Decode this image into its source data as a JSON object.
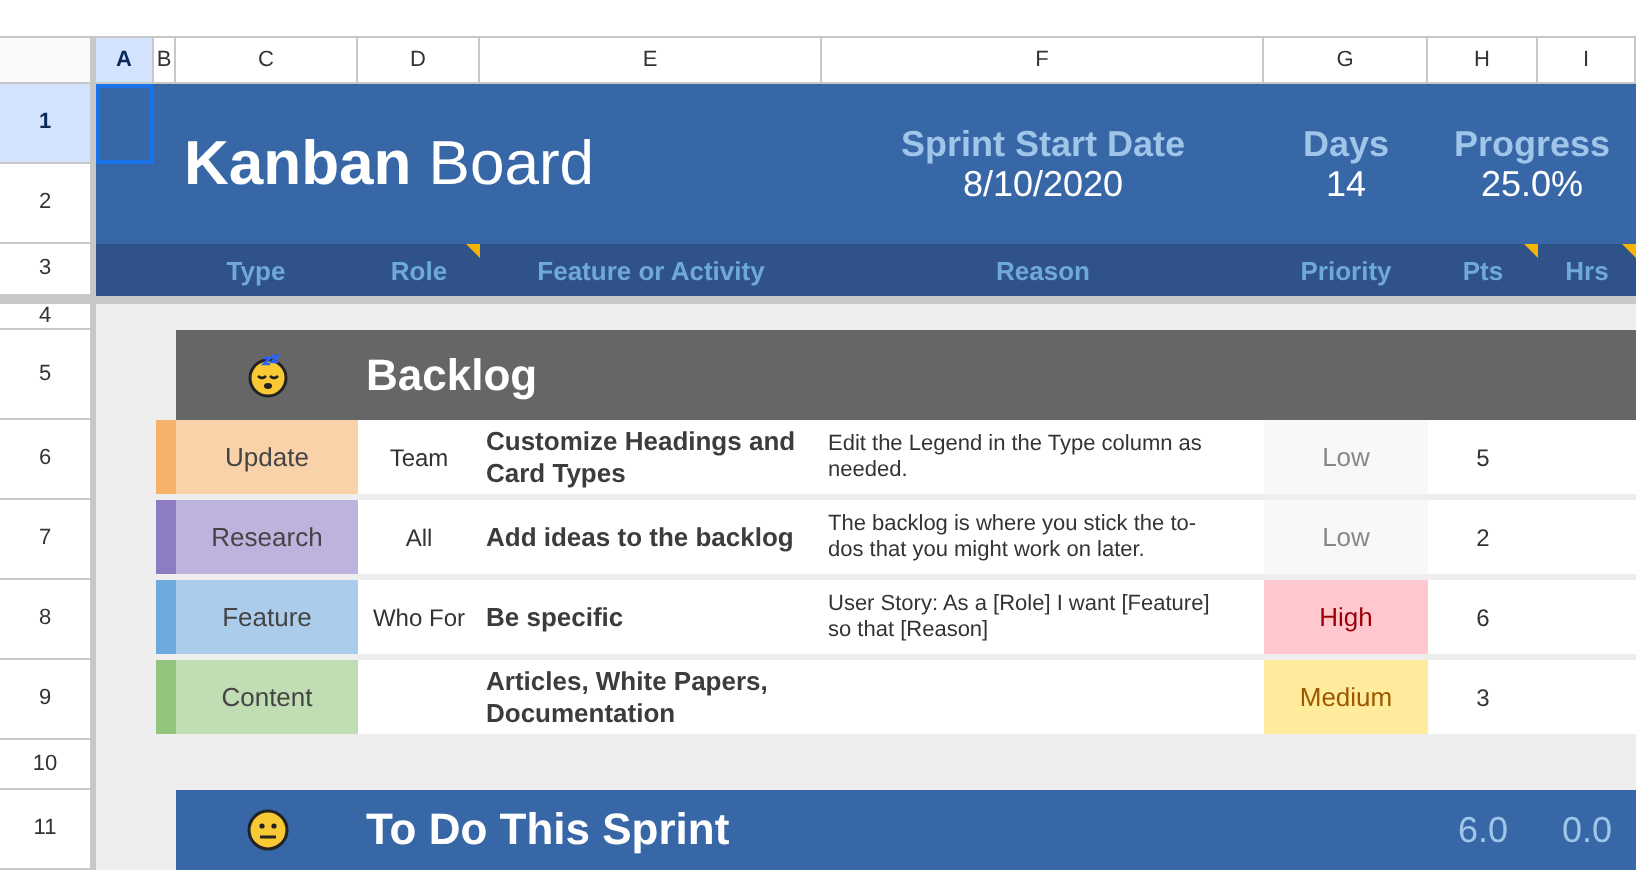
{
  "column_headers": [
    {
      "label": "A",
      "selected": true
    },
    {
      "label": "B",
      "selected": false
    },
    {
      "label": "C",
      "selected": false
    },
    {
      "label": "D",
      "selected": false
    },
    {
      "label": "E",
      "selected": false
    },
    {
      "label": "F",
      "selected": false
    },
    {
      "label": "G",
      "selected": false
    },
    {
      "label": "H",
      "selected": false
    },
    {
      "label": "I",
      "selected": false
    }
  ],
  "row_headers": [
    {
      "label": "1",
      "selected": true
    },
    {
      "label": "2",
      "selected": false
    },
    {
      "label": "3",
      "selected": false
    },
    {
      "label": "4",
      "selected": false
    },
    {
      "label": "5",
      "selected": false
    },
    {
      "label": "6",
      "selected": false
    },
    {
      "label": "7",
      "selected": false
    },
    {
      "label": "8",
      "selected": false
    },
    {
      "label": "9",
      "selected": false
    },
    {
      "label": "10",
      "selected": false
    },
    {
      "label": "11",
      "selected": false
    }
  ],
  "banner": {
    "title": "**Kanban** Board",
    "sprint_start_label": "Sprint Start Date",
    "sprint_start": "8/10/2020",
    "days_label": "Days",
    "days": "14",
    "progress_label": "Progress",
    "progress": "25.0%"
  },
  "table_header": [
    {
      "label": "Type",
      "note": false
    },
    {
      "label": "Role",
      "note": true
    },
    {
      "label": "Feature or Activity",
      "note": false
    },
    {
      "label": "Reason",
      "note": false
    },
    {
      "label": "Priority",
      "note": false
    },
    {
      "label": "Pts",
      "note": true
    },
    {
      "label": "Hrs",
      "note": true
    }
  ],
  "sections": [
    {
      "title": "Backlog",
      "kind": "sleepy",
      "color": "#666666",
      "cards": [
        {
          "type": "Update",
          "color": "#f6b26b",
          "role": "Team",
          "feature": "Customize Headings and Card Types",
          "reason": "Edit the Legend in the Type column as needed.",
          "priority": {
            "text": "Low",
            "kind": "low"
          },
          "pts": "5"
        },
        {
          "type": "Research",
          "color": "#8e7cc3",
          "role": "All",
          "feature": "Add ideas to the backlog",
          "reason": "The backlog is where you stick the to-dos that you might work on later.",
          "priority": {
            "text": "Low",
            "kind": "low"
          },
          "pts": "2"
        },
        {
          "type": "Feature",
          "color": "#6fa8dc",
          "role": "Who For",
          "feature": "Be specific",
          "reason": "User Story: As a [Role] I want [Feature] so that [Reason]",
          "priority": {
            "text": "High",
            "kind": "high"
          },
          "pts": "6"
        },
        {
          "type": "Content",
          "color": "#93c47d",
          "feature": "Articles, White Papers, Documentation",
          "priority": {
            "text": "Medium",
            "kind": "medium"
          },
          "pts": "3"
        }
      ]
    },
    {
      "title": "To Do This Sprint",
      "kind": "neutral",
      "color": "#3867a8",
      "pts_total": "6.0",
      "hrs_total": "0.0"
    }
  ]
}
